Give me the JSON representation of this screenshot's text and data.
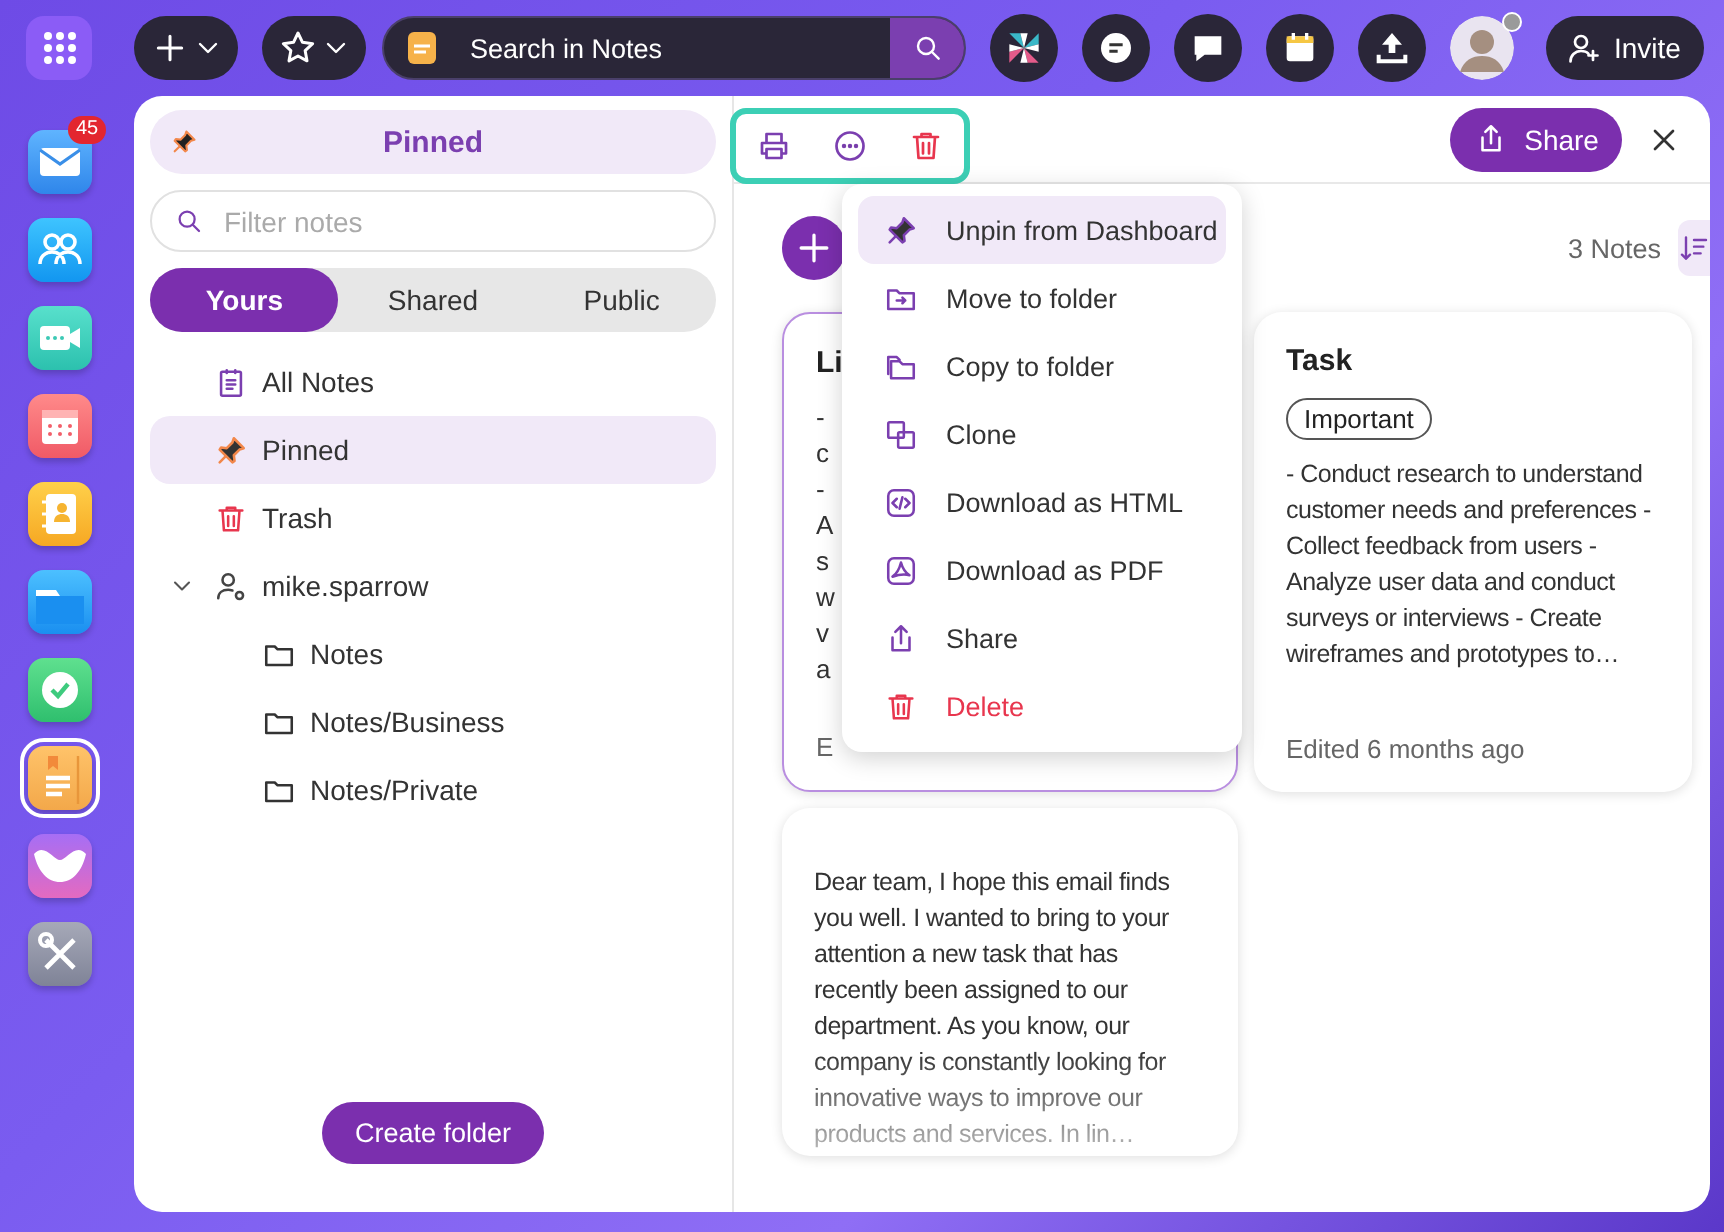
{
  "top_bar": {
    "search": {
      "placeholder": "Search in Notes"
    },
    "invite": "Invite"
  },
  "dock": [
    {
      "kind": "mail",
      "badge": "45",
      "selected": false
    },
    {
      "kind": "contacts",
      "selected": false
    },
    {
      "kind": "video",
      "selected": false
    },
    {
      "kind": "calendar",
      "selected": false
    },
    {
      "kind": "addressbook",
      "selected": false
    },
    {
      "kind": "files",
      "selected": false
    },
    {
      "kind": "tasks",
      "selected": false
    },
    {
      "kind": "notes",
      "selected": true
    },
    {
      "kind": "chat",
      "selected": false
    },
    {
      "kind": "tools",
      "selected": false
    }
  ],
  "sidebar": {
    "header": "Pinned",
    "filter": {
      "placeholder": "Filter notes"
    },
    "tabs": [
      {
        "label": "Yours",
        "selected": true
      },
      {
        "label": "Shared",
        "selected": false
      },
      {
        "label": "Public",
        "selected": false
      }
    ],
    "tree": [
      {
        "label": "All Notes",
        "kind": "all",
        "selected": false
      },
      {
        "label": "Pinned",
        "kind": "pinned",
        "selected": true
      },
      {
        "label": "Trash",
        "kind": "trash",
        "selected": false
      },
      {
        "label": "mike.sparrow",
        "kind": "user",
        "selected": false,
        "expanded": true,
        "children": [
          {
            "label": "Notes",
            "kind": "folder",
            "selected": false
          },
          {
            "label": "Notes/Business",
            "kind": "folder",
            "selected": false
          },
          {
            "label": "Notes/Private",
            "kind": "folder",
            "selected": false
          }
        ]
      }
    ],
    "create_folder": "Create folder"
  },
  "notes_pane": {
    "share": "Share",
    "count": "3 Notes",
    "notes": [
      {
        "kind": "covered",
        "selected": true,
        "title": "Li",
        "lines": [
          "-",
          "c",
          "-",
          "A",
          "s",
          "w",
          "v",
          "a"
        ],
        "footer": "E"
      },
      {
        "kind": "full",
        "selected": false,
        "title": "Task",
        "tag": "Important",
        "body": "- Conduct research to understand customer needs and preferences - Collect feedback from users - Analyze user data and conduct surveys or interviews - Create wireframes and prototypes to…",
        "footer": "Edited 6 months ago"
      },
      {
        "kind": "text",
        "selected": false,
        "body": "Dear team, I hope this email finds you well. I wanted to bring to your attention a new task that has recently been assigned to our department. As you know, our company is constantly looking for innovative ways to improve our products and services. In lin…"
      }
    ]
  },
  "context_menu": [
    {
      "label": "Unpin from Dashboard",
      "kind": "unpin",
      "selected": true
    },
    {
      "label": "Move to folder",
      "kind": "move",
      "selected": false
    },
    {
      "label": "Copy to folder",
      "kind": "copy",
      "selected": false
    },
    {
      "label": "Clone",
      "kind": "clone",
      "selected": false
    },
    {
      "label": "Download as HTML",
      "kind": "html",
      "selected": false
    },
    {
      "label": "Download as PDF",
      "kind": "pdf",
      "selected": false
    },
    {
      "label": "Share",
      "kind": "share",
      "selected": false
    },
    {
      "label": "Delete",
      "kind": "delete",
      "selected": false
    }
  ]
}
